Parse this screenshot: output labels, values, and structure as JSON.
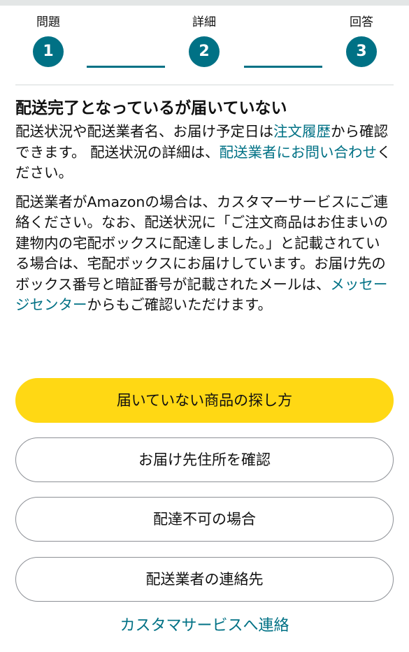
{
  "stepper": {
    "steps": [
      {
        "label": "問題",
        "number": "1"
      },
      {
        "label": "詳細",
        "number": "2"
      },
      {
        "label": "回答",
        "number": "3"
      }
    ],
    "accent_color": "#007185"
  },
  "content": {
    "heading": "配送完了となっているが届いていない",
    "para1": {
      "text_a": "配送状況や配送業者名、お届け予定日は",
      "link_order_history": "注文履歴",
      "text_b": "から確認できます。 配送状況の詳細は、",
      "link_carrier_contact": "配送業者にお問い合わせ",
      "text_c": "ください。"
    },
    "para2": {
      "text_a": "配送業者がAmazonの場合は、カスタマーサービスにご連絡ください。なお、配送状況に「ご注文商品はお住まいの建物内の宅配ボックスに配達しました。」と記載されている場合は、宅配ボックスにお届けしています。お届け先のボックス番号と暗証番号が記載されたメールは、",
      "link_message_center": "メッセージセンター",
      "text_b": "からもご確認いただけます。"
    }
  },
  "buttons": {
    "find_missing": "届いていない商品の探し方",
    "confirm_address": "お届け先住所を確認",
    "undeliverable": "配達不可の場合",
    "carrier_contact": "配送業者の連絡先"
  },
  "footer": {
    "contact_cs": "カスタマサービスへ連絡"
  },
  "colors": {
    "primary_button": "#ffd814",
    "link": "#007185"
  }
}
